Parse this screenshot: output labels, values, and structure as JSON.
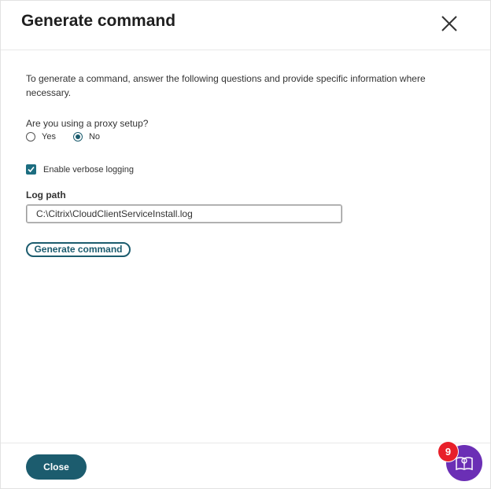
{
  "dialog": {
    "title": "Generate command",
    "close_icon": "close-x-icon"
  },
  "form": {
    "intro": "To generate a command, answer the following questions and provide specific information where necessary.",
    "proxy_question": "Are you using a proxy setup?",
    "proxy_options": [
      {
        "label": "Yes",
        "selected": false
      },
      {
        "label": "No",
        "selected": true
      }
    ],
    "verbose_logging": {
      "label": "Enable verbose logging",
      "checked": true
    },
    "log_path": {
      "label": "Log path",
      "value": "C:\\Citrix\\CloudClientServiceInstall.log"
    },
    "generate_button": "Generate command"
  },
  "footer": {
    "close_button": "Close"
  },
  "help_widget": {
    "icon": "book-lightbulb-icon",
    "badge_count": "9"
  },
  "colors": {
    "accent": "#1c5c6e",
    "checkbox": "#1c6d80",
    "help_purple": "#6b2fb5",
    "badge_red": "#e8202a"
  }
}
